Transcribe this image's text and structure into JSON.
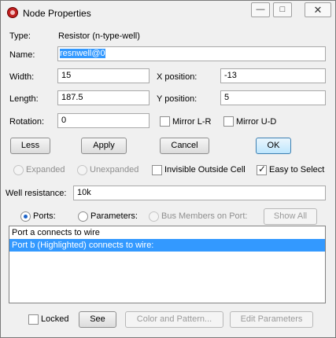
{
  "window": {
    "title": "Node Properties",
    "controls": {
      "minimize": "—",
      "maximize": "□",
      "close": "✕"
    }
  },
  "type": {
    "label": "Type:",
    "value": "Resistor (n-type-well)"
  },
  "name": {
    "label": "Name:",
    "value": "resnwell@0"
  },
  "width": {
    "label": "Width:",
    "value": "15"
  },
  "xpos": {
    "label": "X position:",
    "value": "-13"
  },
  "length": {
    "label": "Length:",
    "value": "187.5"
  },
  "ypos": {
    "label": "Y position:",
    "value": "5"
  },
  "rotation": {
    "label": "Rotation:",
    "value": "0"
  },
  "mirror_lr": {
    "label": "Mirror L-R",
    "checked": false
  },
  "mirror_ud": {
    "label": "Mirror U-D",
    "checked": false
  },
  "buttons": {
    "less": "Less",
    "apply": "Apply",
    "cancel": "Cancel",
    "ok": "OK"
  },
  "expand": {
    "expanded": "Expanded",
    "unexpanded": "Unexpanded",
    "invisible_outside": "Invisible Outside Cell",
    "easy_to_select": "Easy to Select",
    "easy_checked": true
  },
  "well_resistance": {
    "label": "Well resistance:",
    "value": "10k"
  },
  "view": {
    "ports": "Ports:",
    "parameters": "Parameters:",
    "bus_members": "Bus Members on Port:",
    "show_all": "Show All",
    "selected": "ports"
  },
  "list_items": [
    "Port a connects to wire",
    "Port b (Highlighted) connects to wire:"
  ],
  "bottom": {
    "locked": "Locked",
    "see": "See",
    "color_pattern": "Color and Pattern...",
    "edit_parameters": "Edit Parameters"
  },
  "colors": {
    "selection": "#3399ff",
    "default_button": "#bee6fd",
    "title_icon": "#c02020"
  }
}
